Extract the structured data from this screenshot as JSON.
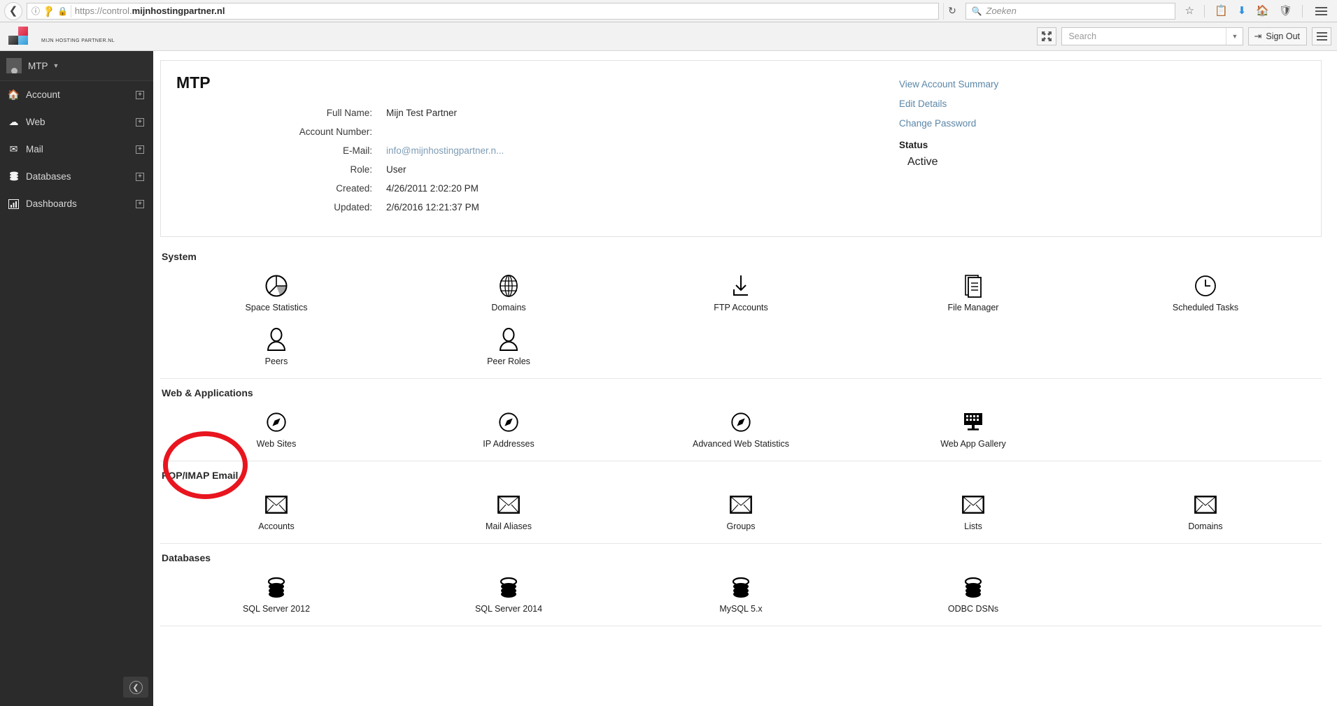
{
  "browser": {
    "back_icon": "back-arrow-icon",
    "url_prefix": "https://control.",
    "url_domain": "mijnhostingpartner.nl",
    "url_full": "https://control.mijnhostingpartner.nl",
    "reload_icon": "reload-icon",
    "search_placeholder": "Zoeken",
    "icons": [
      "bookmark-star-icon",
      "reading-list-icon",
      "downloads-icon",
      "home-icon",
      "pocket-icon",
      "menu-icon"
    ]
  },
  "header": {
    "brand_text": "MIJN HOSTING PARTNER.NL",
    "expand_icon": "expand-arrows-icon",
    "search_placeholder": "Search",
    "sign_out_label": "Sign Out",
    "menu_icon": "hamburger-menu-icon"
  },
  "sidebar": {
    "user": "MTP",
    "items": [
      {
        "label": "Account",
        "icon": "home-icon",
        "expander": "+"
      },
      {
        "label": "Web",
        "icon": "cloud-icon",
        "expander": "+"
      },
      {
        "label": "Mail",
        "icon": "envelope-icon",
        "expander": "+"
      },
      {
        "label": "Databases",
        "icon": "database-icon",
        "expander": "+"
      },
      {
        "label": "Dashboards",
        "icon": "bar-chart-icon",
        "expander": "+"
      }
    ],
    "collapse_icon": "collapse-left-arrow-icon"
  },
  "account": {
    "title": "MTP",
    "fields": [
      {
        "label": "Full Name:",
        "value": "Mijn Test Partner",
        "is_link": false
      },
      {
        "label": "Account Number:",
        "value": "",
        "is_link": false
      },
      {
        "label": "E-Mail:",
        "value": "info@mijnhostingpartner.n...",
        "is_link": true
      },
      {
        "label": "Role:",
        "value": "User",
        "is_link": false
      },
      {
        "label": "Created:",
        "value": "4/26/2011 2:02:20 PM",
        "is_link": false
      },
      {
        "label": "Updated:",
        "value": "2/6/2016 12:21:37 PM",
        "is_link": false
      }
    ],
    "links": [
      "View Account Summary",
      "Edit Details",
      "Change Password"
    ],
    "status_label": "Status",
    "status_value": "Active"
  },
  "sections": [
    {
      "title": "System",
      "tiles": [
        {
          "label": "Space Statistics",
          "icon": "pie-chart-icon"
        },
        {
          "label": "Domains",
          "icon": "globe-icon"
        },
        {
          "label": "FTP Accounts",
          "icon": "download-arrow-icon"
        },
        {
          "label": "File Manager",
          "icon": "document-icon"
        },
        {
          "label": "Scheduled Tasks",
          "icon": "clock-icon"
        },
        {
          "label": "Peers",
          "icon": "person-icon"
        },
        {
          "label": "Peer Roles",
          "icon": "person-icon"
        }
      ]
    },
    {
      "title": "Web & Applications",
      "tiles": [
        {
          "label": "Web Sites",
          "icon": "compass-icon",
          "highlighted": true
        },
        {
          "label": "IP Addresses",
          "icon": "compass-icon"
        },
        {
          "label": "Advanced Web Statistics",
          "icon": "compass-icon"
        },
        {
          "label": "Web App Gallery",
          "icon": "monitor-icon"
        }
      ]
    },
    {
      "title": "POP/IMAP Email",
      "tiles": [
        {
          "label": "Accounts",
          "icon": "envelope-icon"
        },
        {
          "label": "Mail Aliases",
          "icon": "envelope-icon"
        },
        {
          "label": "Groups",
          "icon": "envelope-icon"
        },
        {
          "label": "Lists",
          "icon": "envelope-icon"
        },
        {
          "label": "Domains",
          "icon": "envelope-icon"
        }
      ]
    },
    {
      "title": "Databases",
      "tiles": [
        {
          "label": "SQL Server 2012",
          "icon": "database-icon"
        },
        {
          "label": "SQL Server 2014",
          "icon": "database-icon"
        },
        {
          "label": "MySQL 5.x",
          "icon": "database-icon"
        },
        {
          "label": "ODBC DSNs",
          "icon": "database-icon"
        }
      ]
    }
  ],
  "annotation": {
    "shape": "ellipse",
    "color": "#e8151f",
    "target": "Web Sites"
  }
}
